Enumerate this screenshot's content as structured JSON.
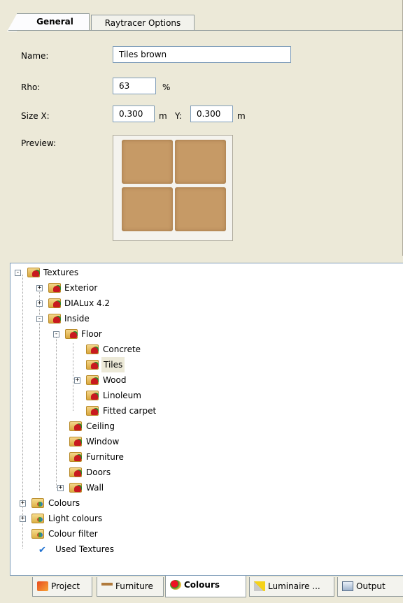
{
  "tabs": {
    "general": "General",
    "raytracer": "Raytracer Options"
  },
  "form": {
    "name_label": "Name:",
    "name_value": "Tiles brown",
    "rho_label": "Rho:",
    "rho_value": "63",
    "rho_unit": "%",
    "size_label": "Size X:",
    "size_x_value": "0.300",
    "size_x_unit": "m",
    "y_label": "Y:",
    "size_y_value": "0.300",
    "size_y_unit": "m",
    "preview_label": "Preview:"
  },
  "tree": {
    "textures": "Textures",
    "exterior": "Exterior",
    "dialux": "DIALux 4.2",
    "inside": "Inside",
    "floor": "Floor",
    "concrete": "Concrete",
    "tiles": "Tiles",
    "wood": "Wood",
    "linoleum": "Linoleum",
    "fitted_carpet": "Fitted carpet",
    "ceiling": "Ceiling",
    "window": "Window",
    "furniture": "Furniture",
    "doors": "Doors",
    "wall": "Wall",
    "colours": "Colours",
    "light_colours": "Light colours",
    "colour_filter": "Colour filter",
    "used_textures": "Used Textures"
  },
  "bottom_tabs": {
    "project": "Project",
    "furniture": "Furniture",
    "colours": "Colours",
    "luminaire": "Luminaire ...",
    "output": "Output"
  },
  "colors": {
    "selected_background": "#ece9d8",
    "texture_tile": "#c69a66",
    "border": "#7f9db9"
  }
}
